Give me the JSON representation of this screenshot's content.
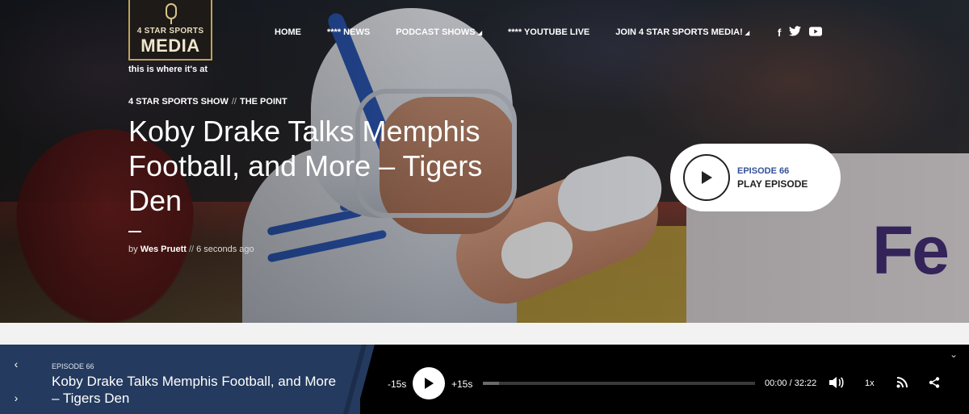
{
  "logo": {
    "top_text": "4 STAR SPORTS",
    "main_text": "MEDIA",
    "tagline": "this is where it's at"
  },
  "nav": {
    "items": [
      {
        "label": "HOME",
        "has_dropdown": false
      },
      {
        "label": "**** NEWS",
        "has_dropdown": false
      },
      {
        "label": "PODCAST SHOWS",
        "has_dropdown": true
      },
      {
        "label": "**** YOUTUBE LIVE",
        "has_dropdown": false
      },
      {
        "label": "JOIN 4 STAR SPORTS MEDIA!",
        "has_dropdown": true
      }
    ],
    "social": {
      "facebook": "f",
      "twitter": "twitter-icon",
      "youtube": "youtube-icon"
    }
  },
  "hero": {
    "categories": [
      "4 STAR SPORTS SHOW",
      "THE POINT"
    ],
    "category_separator": "//",
    "title": "Koby Drake Talks Memphis Football, and More – Tigers Den",
    "byline_prefix": "by",
    "author": "Wes Pruett",
    "byline_separator": "//",
    "time_ago": "6 seconds ago",
    "background_sponsor_text": "Fe",
    "play_button": {
      "episode_label": "EPISODE 66",
      "action_label": "PLAY EPISODE"
    }
  },
  "player": {
    "episode_label": "EPISODE 66",
    "episode_title": "Koby Drake Talks Memphis Football, and More – Tigers Den",
    "skip_back": "-15s",
    "skip_forward": "+15s",
    "current_time": "00:00",
    "time_separator": "/",
    "duration": "32:22",
    "speed": "1x",
    "progress_fraction": 0.06
  },
  "colors": {
    "accent_blue": "#34509a",
    "panel_blue": "#243a5e",
    "player_bg": "#000000",
    "logo_gold": "#bfa15a"
  }
}
